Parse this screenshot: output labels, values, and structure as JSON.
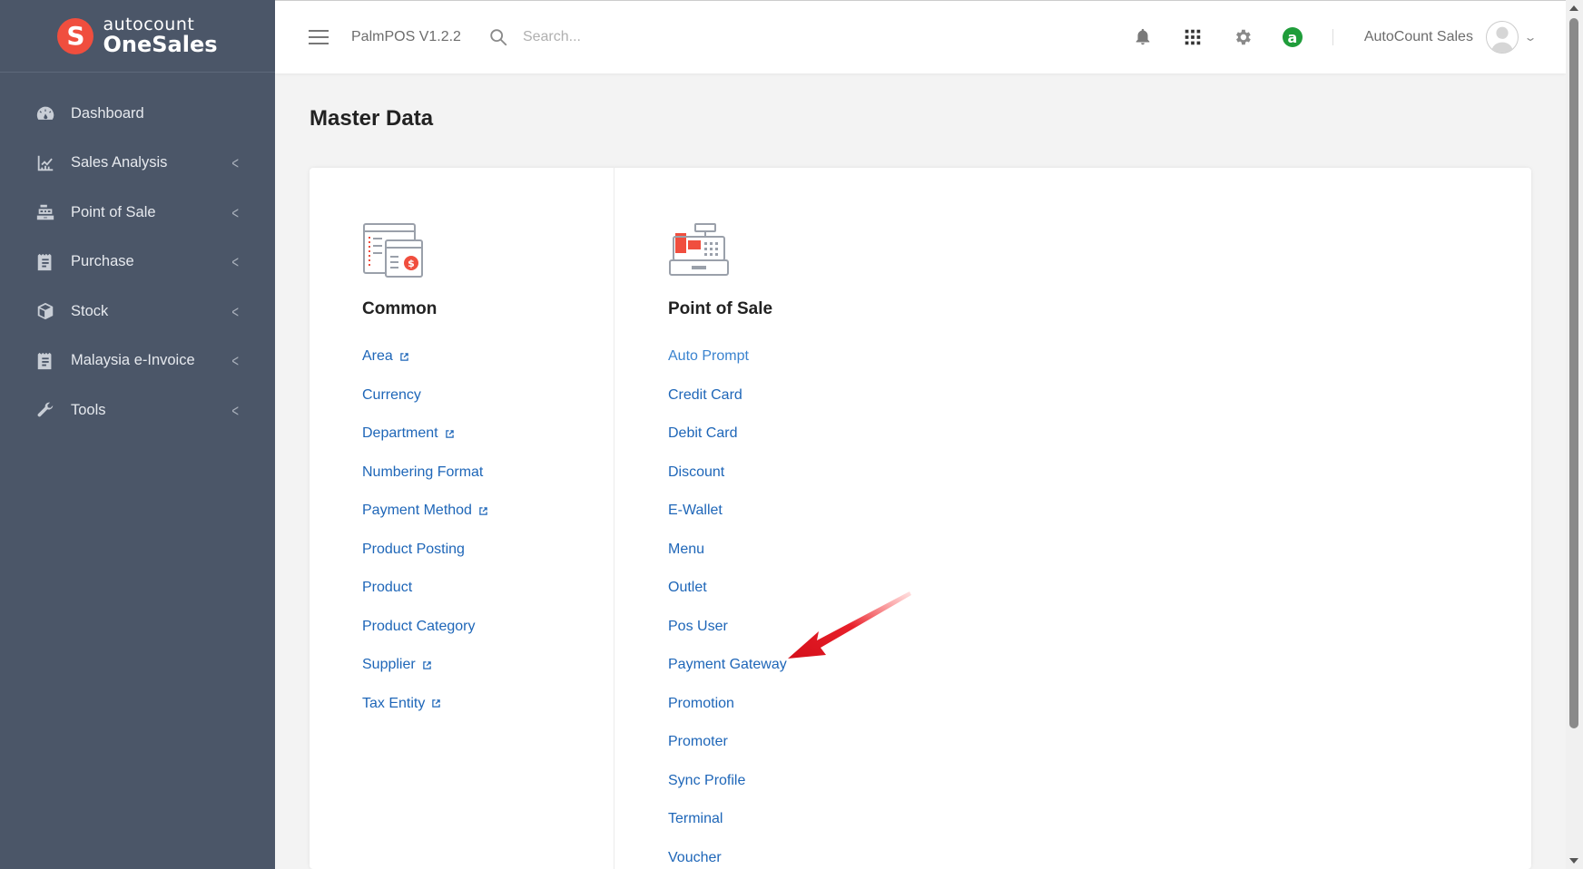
{
  "brand": {
    "logo_letter": "S",
    "name_top": "autocount",
    "name_bottom": "OneSales",
    "color": "#f04e3e"
  },
  "sidebar": {
    "items": [
      {
        "label": "Dashboard",
        "icon": "dashboard-icon",
        "expandable": false
      },
      {
        "label": "Sales Analysis",
        "icon": "chart-icon",
        "expandable": true
      },
      {
        "label": "Point of Sale",
        "icon": "cash-register-icon",
        "expandable": true
      },
      {
        "label": "Purchase",
        "icon": "receipt-icon",
        "expandable": true
      },
      {
        "label": "Stock",
        "icon": "box-icon",
        "expandable": true
      },
      {
        "label": "Malaysia e-Invoice",
        "icon": "invoice-icon",
        "expandable": true
      },
      {
        "label": "Tools",
        "icon": "wrench-icon",
        "expandable": true
      }
    ]
  },
  "topbar": {
    "app_version": "PalmPOS V1.2.2",
    "search_placeholder": "Search...",
    "badge_letter": "a",
    "user_name": "AutoCount Sales"
  },
  "page": {
    "title": "Master Data"
  },
  "columns": {
    "common": {
      "title": "Common",
      "links": [
        {
          "label": "Area",
          "external": true
        },
        {
          "label": "Currency",
          "external": false
        },
        {
          "label": "Department",
          "external": true
        },
        {
          "label": "Numbering Format",
          "external": false
        },
        {
          "label": "Payment Method",
          "external": true
        },
        {
          "label": "Product Posting",
          "external": false
        },
        {
          "label": "Product",
          "external": false
        },
        {
          "label": "Product Category",
          "external": false
        },
        {
          "label": "Supplier",
          "external": true
        },
        {
          "label": "Tax Entity",
          "external": true
        }
      ]
    },
    "pos": {
      "title": "Point of Sale",
      "links": [
        {
          "label": "Auto Prompt"
        },
        {
          "label": "Credit Card"
        },
        {
          "label": "Debit Card"
        },
        {
          "label": "Discount"
        },
        {
          "label": "E-Wallet"
        },
        {
          "label": "Menu"
        },
        {
          "label": "Outlet"
        },
        {
          "label": "Pos User"
        },
        {
          "label": "Payment Gateway"
        },
        {
          "label": "Promotion"
        },
        {
          "label": "Promoter"
        },
        {
          "label": "Sync Profile"
        },
        {
          "label": "Terminal"
        },
        {
          "label": "Voucher"
        }
      ]
    }
  },
  "colors": {
    "sidebar_bg": "#4b5668",
    "link": "#1e66b8",
    "accent_red": "#f04e3e",
    "badge_green": "#1f9d3a"
  }
}
